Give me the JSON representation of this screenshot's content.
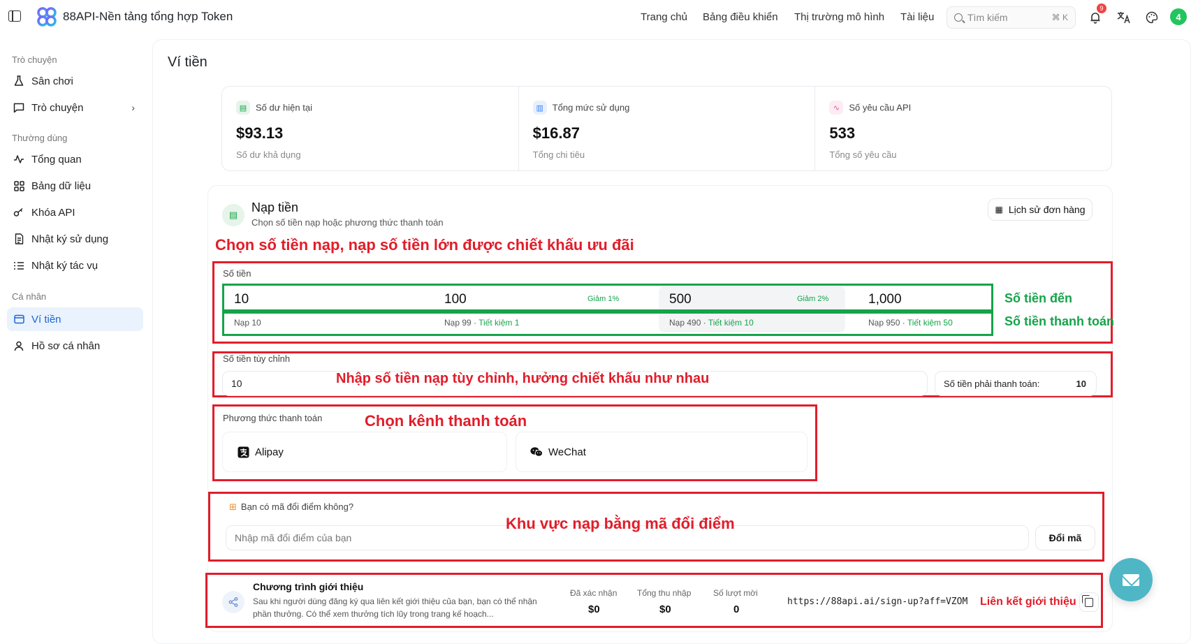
{
  "header": {
    "app_title": "88API-Nền tảng tổng hợp Token",
    "nav": [
      "Trang chủ",
      "Bảng điều khiển",
      "Thị trường mô hình",
      "Tài liệu"
    ],
    "search_placeholder": "Tìm kiếm",
    "search_shortcut": "⌘ K",
    "notification_count": "9",
    "avatar_initial": "4"
  },
  "sidebar": {
    "groups": [
      {
        "title": "Trò chuyện",
        "items": [
          {
            "label": "Sân chơi",
            "icon": "flask-icon"
          },
          {
            "label": "Trò chuyện",
            "icon": "chat-icon"
          }
        ]
      },
      {
        "title": "Thường dùng",
        "items": [
          {
            "label": "Tổng quan",
            "icon": "activity-icon"
          },
          {
            "label": "Bảng dữ liệu",
            "icon": "grid-icon"
          },
          {
            "label": "Khóa API",
            "icon": "key-icon"
          },
          {
            "label": "Nhật ký sử dụng",
            "icon": "document-icon"
          },
          {
            "label": "Nhật ký tác vụ",
            "icon": "list-icon"
          }
        ]
      },
      {
        "title": "Cá nhân",
        "items": [
          {
            "label": "Ví tiền",
            "icon": "wallet-icon"
          },
          {
            "label": "Hồ sơ cá nhân",
            "icon": "user-icon"
          }
        ]
      }
    ],
    "active": "Ví tiền"
  },
  "page": {
    "title": "Ví tiền"
  },
  "stats": [
    {
      "label": "Số dư hiện tại",
      "value": "$93.13",
      "sub": "Số dư khả dụng"
    },
    {
      "label": "Tổng mức sử dụng",
      "value": "$16.87",
      "sub": "Tổng chi tiêu"
    },
    {
      "label": "Số yêu cầu API",
      "value": "533",
      "sub": "Tổng số yêu cầu"
    }
  ],
  "topup": {
    "title": "Nạp tiền",
    "subtitle": "Chọn số tiền nạp hoặc phương thức thanh toán",
    "order_history": "Lịch sử đơn hàng",
    "amount_label": "Số tiền",
    "amounts": [
      {
        "value": "10",
        "badge": "",
        "pay": "Nạp 10",
        "save": ""
      },
      {
        "value": "100",
        "badge": "Giảm 1%",
        "pay": "Nạp 99",
        "save": "Tiết kiệm 1"
      },
      {
        "value": "500",
        "badge": "Giảm 2%",
        "pay": "Nạp 490",
        "save": "Tiết kiệm 10"
      },
      {
        "value": "1,000",
        "badge": "",
        "pay": "Nạp 950",
        "save": "Tiết kiệm 50"
      }
    ],
    "custom_label": "Số tiền tùy chỉnh",
    "custom_value": "10",
    "pay_due_label": "Số tiền phải thanh toán:",
    "pay_due_value": "10",
    "method_label": "Phương thức thanh toán",
    "methods": [
      "Alipay",
      "WeChat"
    ],
    "redeem_question": "Bạn có mã đổi điểm không?",
    "redeem_placeholder": "Nhập mã đổi điểm của bạn",
    "redeem_button": "Đổi mã"
  },
  "referral": {
    "title": "Chương trình giới thiệu",
    "desc": "Sau khi người dùng đăng ký qua liên kết giới thiệu của bạn, bạn có thể nhận phần thưởng. Có thể xem thưởng tích lũy trong trang kế hoạch...",
    "stats": [
      {
        "label": "Đã xác nhận",
        "value": "$0"
      },
      {
        "label": "Tổng thu nhập",
        "value": "$0"
      },
      {
        "label": "Số lượt mời",
        "value": "0"
      }
    ],
    "link": "https://88api.ai/sign-up?aff=VZOM"
  },
  "annotations": {
    "choose_amount": "Chọn số tiền nạp, nạp số tiền lớn được chiết khấu ưu đãi",
    "credited_amount": "Số tiền đến",
    "payment_amount": "Số tiền thanh toán",
    "custom_amount": "Nhập số tiền nạp tùy chỉnh, hưởng chiết khấu như nhau",
    "choose_channel": "Chọn kênh thanh toán",
    "redeem_area": "Khu vực nạp bằng mã đổi điểm",
    "referral_link": "Liên kết giới thiệu"
  },
  "colors": {
    "annotation_red": "#e11d2a",
    "annotation_green": "#16a34a",
    "active_nav": "#1a66d6",
    "fab": "#4fb6c6"
  }
}
